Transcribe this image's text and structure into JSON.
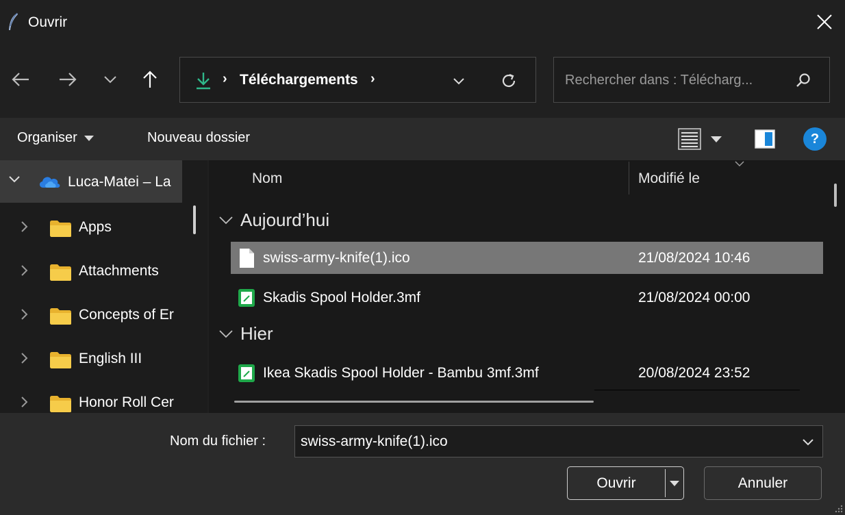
{
  "window": {
    "title": "Ouvrir",
    "icon": "feather-icon",
    "close_icon": "close-icon"
  },
  "nav": {
    "back_icon": "arrow-left-icon",
    "forward_icon": "arrow-right-icon",
    "recent_icon": "chevron-down-icon",
    "up_icon": "arrow-up-icon"
  },
  "address": {
    "location_icon": "download-icon",
    "separator": "›",
    "crumb": "Téléchargements",
    "dropdown_icon": "chevron-down-icon",
    "refresh_icon": "refresh-icon"
  },
  "search": {
    "placeholder": "Rechercher dans : Télécharg...",
    "icon": "search-icon"
  },
  "toolbar": {
    "organise_label": "Organiser",
    "new_folder_label": "Nouveau dossier",
    "view_icon": "details-view-icon",
    "preview_icon": "preview-pane-icon",
    "help_label": "?"
  },
  "tree": {
    "root": {
      "label": "Luca-Matei – La",
      "icon": "onedrive-cloud-icon"
    },
    "items": [
      {
        "label": "Apps",
        "icon": "folder-icon"
      },
      {
        "label": "Attachments",
        "icon": "folder-icon"
      },
      {
        "label": "Concepts of Er",
        "icon": "folder-icon"
      },
      {
        "label": "English III",
        "icon": "folder-icon"
      },
      {
        "label": "Honor Roll Cer",
        "icon": "folder-icon"
      }
    ]
  },
  "columns": {
    "name": "Nom",
    "modified": "Modifié le"
  },
  "groups": [
    {
      "label": "Aujourd’hui",
      "files": [
        {
          "name": "swiss-army-knife(1).ico",
          "date": "21/08/2024 10:46",
          "icon": "blank-file-icon",
          "selected": true
        },
        {
          "name": "Skadis Spool Holder.3mf",
          "date": "21/08/2024 00:00",
          "icon": "3mf-file-icon",
          "selected": false
        }
      ]
    },
    {
      "label": "Hier",
      "files": [
        {
          "name": "Ikea Skadis Spool Holder - Bambu 3mf.3mf",
          "date": "20/08/2024 23:52",
          "icon": "3mf-file-icon",
          "selected": false
        }
      ]
    }
  ],
  "bottom": {
    "filename_label": "Nom du fichier :",
    "filename_value": "swiss-army-knife(1).ico",
    "open_label": "Ouvrir",
    "cancel_label": "Annuler"
  },
  "colors": {
    "accent": "#1a86d9",
    "selection": "#777777",
    "dl_green": "#2fb88a",
    "folder": "#f0c040",
    "file_3mf": "#1fa84a"
  }
}
